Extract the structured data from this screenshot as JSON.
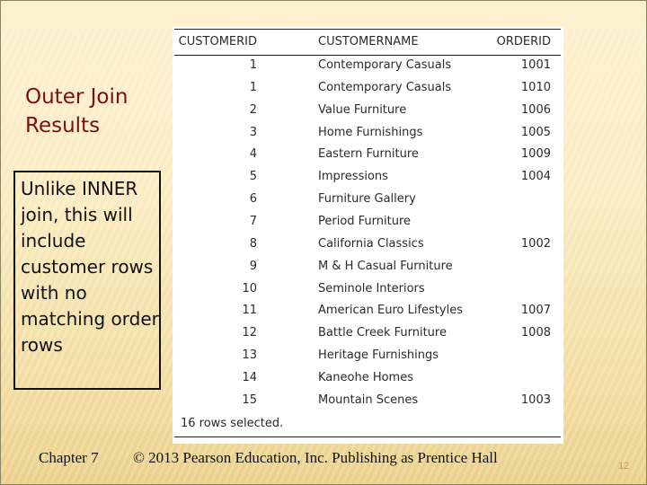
{
  "slide": {
    "title": "Outer Join Results",
    "note": "Unlike INNER join, this will include customer rows with no matching order rows",
    "footer_chapter": "Chapter 7",
    "footer_copyright": "© 2013 Pearson Education, Inc.  Publishing as Prentice Hall",
    "page_number": "12"
  },
  "table": {
    "columns": [
      "CUSTOMERID",
      "CUSTOMERNAME",
      "ORDERID"
    ],
    "rows": [
      {
        "id": "1",
        "name": "Contemporary Casuals",
        "order": "1001"
      },
      {
        "id": "1",
        "name": "Contemporary Casuals",
        "order": "1010"
      },
      {
        "id": "2",
        "name": "Value Furniture",
        "order": "1006"
      },
      {
        "id": "3",
        "name": "Home Furnishings",
        "order": "1005"
      },
      {
        "id": "4",
        "name": "Eastern Furniture",
        "order": "1009"
      },
      {
        "id": "5",
        "name": "Impressions",
        "order": "1004"
      },
      {
        "id": "6",
        "name": "Furniture Gallery",
        "order": ""
      },
      {
        "id": "7",
        "name": "Period Furniture",
        "order": ""
      },
      {
        "id": "8",
        "name": "California Classics",
        "order": "1002"
      },
      {
        "id": "9",
        "name": "M & H Casual Furniture",
        "order": ""
      },
      {
        "id": "10",
        "name": "Seminole Interiors",
        "order": ""
      },
      {
        "id": "11",
        "name": "American Euro Lifestyles",
        "order": "1007"
      },
      {
        "id": "12",
        "name": "Battle Creek Furniture",
        "order": "1008"
      },
      {
        "id": "13",
        "name": "Heritage Furnishings",
        "order": ""
      },
      {
        "id": "14",
        "name": "Kaneohe Homes",
        "order": ""
      },
      {
        "id": "15",
        "name": "Mountain Scenes",
        "order": "1003"
      }
    ],
    "rows_selected": "16 rows selected."
  },
  "colors": {
    "title": "#7a1010",
    "page_number": "#c59a4c",
    "background": "#faebc0"
  }
}
